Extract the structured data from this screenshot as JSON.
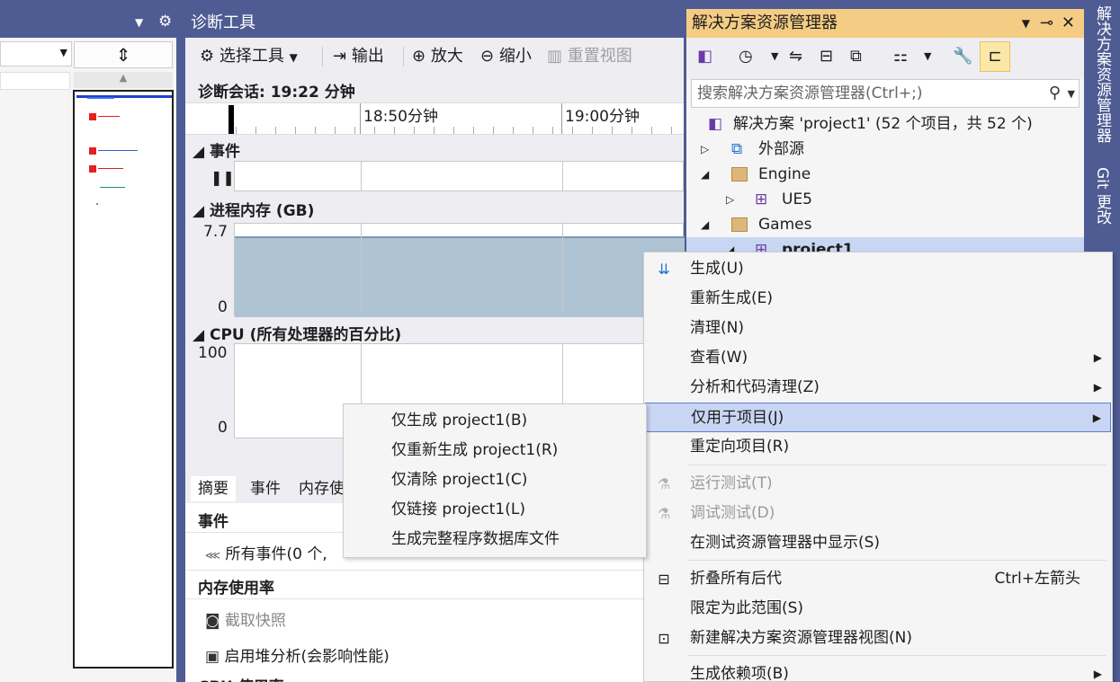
{
  "left": {
    "gear_icon": "gear-icon",
    "split_icon": "split-icon"
  },
  "diag": {
    "title": "诊断工具",
    "toolbar": {
      "select_tools": "选择工具",
      "output": "输出",
      "zoom_in": "放大",
      "zoom_out": "缩小",
      "reset_view": "重置视图"
    },
    "session": "诊断会话: 19:22 分钟",
    "ruler": {
      "tick1": "18:50分钟",
      "tick2": "19:00分钟"
    },
    "events_header": "事件",
    "memory_header": "进程内存 (GB)",
    "memory_max": "7.7",
    "memory_min": "0",
    "cpu_header": "CPU (所有处理器的百分比)",
    "cpu_max": "100",
    "cpu_min": "0",
    "tabs": [
      "摘要",
      "事件",
      "内存使"
    ],
    "summary": {
      "events_hdr": "事件",
      "all_events": "所有事件(0 个,",
      "memory_hdr": "内存使用率",
      "snapshot": "截取快照",
      "heap": "启用堆分析(会影响性能)",
      "cpu_hdr": "CPU 使用率"
    }
  },
  "sol": {
    "title": "解决方案资源管理器",
    "search_placeholder": "搜索解决方案资源管理器(Ctrl+;)",
    "tree": {
      "solution": "解决方案 'project1' (52 个项目，共 52 个)",
      "external": "外部源",
      "engine": "Engine",
      "ue5": "UE5",
      "games": "Games",
      "project": "project1"
    }
  },
  "vbar": {
    "tab1": "解决方案资源管理器",
    "tab2": "Git 更改"
  },
  "context_menu": {
    "build": "生成(U)",
    "rebuild": "重新生成(E)",
    "clean": "清理(N)",
    "view": "查看(W)",
    "analyze": "分析和代码清理(Z)",
    "project_only": "仅用于项目(J)",
    "retarget": "重定向项目(R)",
    "run_tests": "运行测试(T)",
    "debug_tests": "调试测试(D)",
    "show_test_explorer": "在测试资源管理器中显示(S)",
    "collapse": "折叠所有后代",
    "collapse_shortcut": "Ctrl+左箭头",
    "scope": "限定为此范围(S)",
    "new_view": "新建解决方案资源管理器视图(N)",
    "build_deps": "生成依赖项(B)"
  },
  "submenu": {
    "build_only": "仅生成 project1(B)",
    "rebuild_only": "仅重新生成 project1(R)",
    "clean_only": "仅清除 project1(C)",
    "link_only": "仅链接 project1(L)",
    "pdb": "生成完整程序数据库文件"
  }
}
